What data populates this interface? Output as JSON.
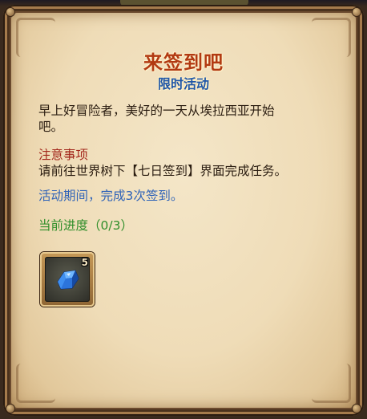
{
  "event": {
    "title": "来签到吧",
    "subtitle": "限时活动"
  },
  "content": {
    "intro_line1": "早上好冒险者，美好的一天从埃拉西亚开始",
    "intro_line2": "吧。",
    "notice_heading": "注意事项",
    "notice_text": "请前往世界树下【七日签到】界面完成任务。",
    "period_text": "活动期间，完成3次签到。",
    "progress_text": "当前进度（0/3）"
  },
  "progress": {
    "current": 0,
    "total": 3
  },
  "reward": {
    "icon": "blue-crystal-icon",
    "count": "5"
  },
  "colors": {
    "title": "#b23a12",
    "subtitle": "#1f56a8",
    "notice_heading": "#a3281c",
    "period": "#2f63b8",
    "progress": "#2f8e2a"
  }
}
